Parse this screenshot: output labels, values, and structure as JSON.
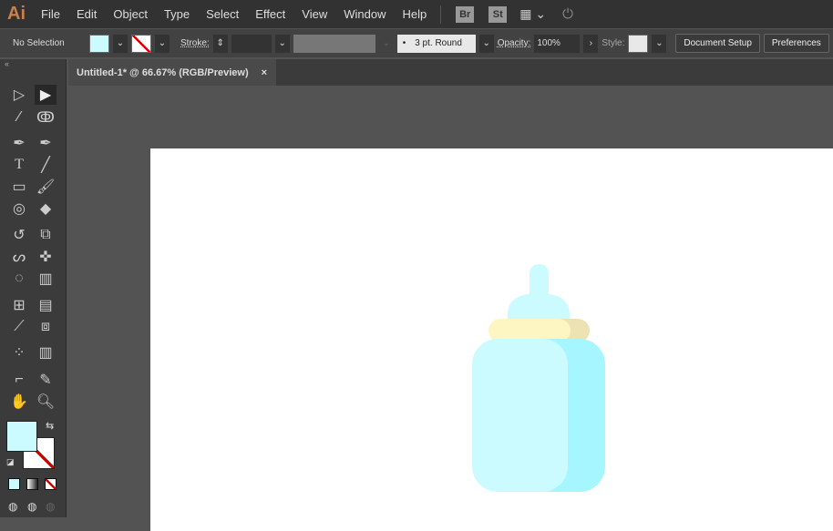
{
  "app": {
    "logo": "Ai"
  },
  "menu": [
    "File",
    "Edit",
    "Object",
    "Type",
    "Select",
    "Effect",
    "View",
    "Window",
    "Help"
  ],
  "menu_icons": {
    "bridge": "Br",
    "stock": "St"
  },
  "control": {
    "selection": "No Selection",
    "fill_color": "#ccfbff",
    "stroke_label": "Stroke:",
    "brush": "3 pt. Round",
    "opacity_label": "Opacity:",
    "opacity": "100%",
    "style_label": "Style:",
    "document_setup": "Document Setup",
    "preferences": "Preferences"
  },
  "document_tab": {
    "title": "Untitled-1* @ 66.67% (RGB/Preview)",
    "close": "×"
  },
  "colors": {
    "bottle_light": "#ccfbff",
    "bottle_dark": "#a6f6ff",
    "cap_light": "#fdf5c2",
    "cap_dark": "#ede3b2"
  }
}
